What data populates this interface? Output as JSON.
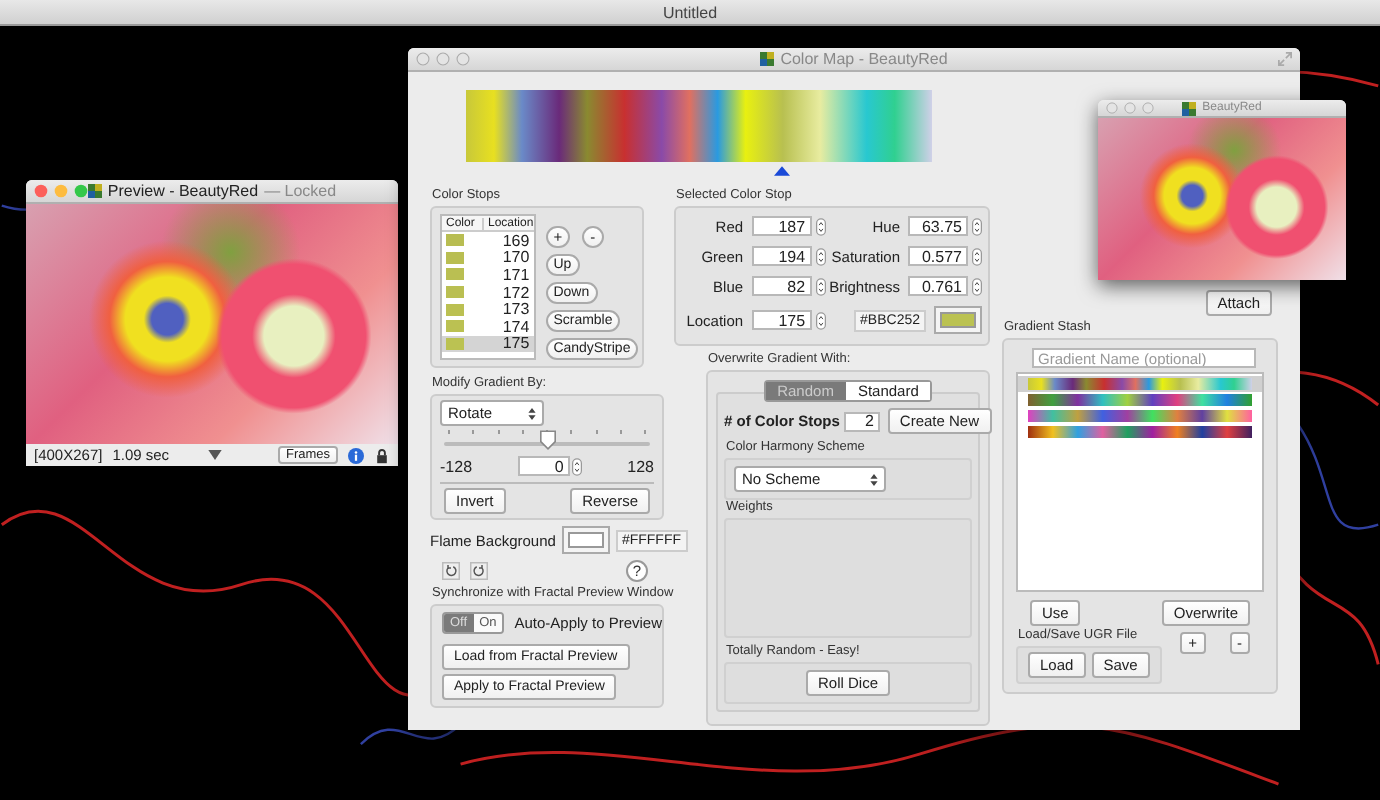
{
  "app_title": "Untitled",
  "preview_window": {
    "title": "Preview - BeautyRed",
    "title_suffix": "— Locked",
    "size": "[400X267]",
    "time": "1.09 sec",
    "frames_button": "Frames"
  },
  "color_map_window": {
    "title": "Color Map - BeautyRed",
    "level": 0.68
  },
  "mini_preview": {
    "title": "BeautyRed"
  },
  "color_stops": {
    "title": "Color Stops",
    "columns": [
      "Color",
      "Location"
    ],
    "rows": [
      {
        "color": "#b8bd52",
        "location": "169",
        "selected": false
      },
      {
        "color": "#b9be52",
        "location": "170",
        "selected": false
      },
      {
        "color": "#babf52",
        "location": "171",
        "selected": false
      },
      {
        "color": "#babf52",
        "location": "172",
        "selected": false
      },
      {
        "color": "#bbc052",
        "location": "173",
        "selected": false
      },
      {
        "color": "#bbc152",
        "location": "174",
        "selected": false
      },
      {
        "color": "#bbc252",
        "location": "175",
        "selected": true
      }
    ],
    "buttons": [
      "+",
      "-",
      "Up",
      "Down",
      "Scramble",
      "CandyStripe"
    ]
  },
  "selected_stop": {
    "title": "Selected Color Stop",
    "fields": [
      {
        "label": "Red",
        "value": "187"
      },
      {
        "label": "Hue",
        "value": "63.75"
      },
      {
        "label": "Green",
        "value": "194"
      },
      {
        "label": "Saturation",
        "value": "0.577"
      },
      {
        "label": "Blue",
        "value": "82"
      },
      {
        "label": "Brightness",
        "value": "0.761"
      },
      {
        "label": "Location",
        "value": "175"
      }
    ],
    "hex": "#BBC252"
  },
  "modify": {
    "title": "Modify Gradient By:",
    "mode": "Rotate",
    "min": "-128",
    "max": "128",
    "value": "0",
    "level": 0.5,
    "buttons": [
      "Invert",
      "Reverse"
    ]
  },
  "flame_background": {
    "label": "Flame Background",
    "value": "#FFFFFF",
    "help_button": "?"
  },
  "sync": {
    "title": "Synchronize with Fractal Preview Window",
    "toggle": [
      {
        "label": "Off",
        "selected": true
      },
      {
        "label": "On",
        "selected": false
      }
    ],
    "auto_apply_label": "Auto-Apply to Preview",
    "buttons": [
      "Load from Fractal Preview",
      "Apply to Fractal Preview"
    ]
  },
  "overwrite": {
    "title": "Overwrite Gradient With:",
    "tabs": [
      {
        "label": "Random",
        "selected": true
      },
      {
        "label": "Standard",
        "selected": false
      }
    ],
    "stops_label": "# of Color Stops",
    "stops_value": "2",
    "create_button": "Create New",
    "harmony_title": "Color Harmony Scheme",
    "scheme": "No Scheme",
    "weights_title": "Weights",
    "random_title": "Totally Random - Easy!",
    "roll_button": "Roll Dice"
  },
  "stash": {
    "attach_button": "Attach",
    "title": "Gradient Stash",
    "name_placeholder": "Gradient Name (optional)",
    "items": [
      {
        "selected": true
      },
      {
        "selected": false
      },
      {
        "selected": false
      },
      {
        "selected": false
      }
    ],
    "use_button": "Use",
    "overwrite_button": "Overwrite",
    "add_button": "+",
    "remove_button": "-",
    "file_title": "Load/Save UGR File",
    "load_button": "Load",
    "save_button": "Save"
  }
}
